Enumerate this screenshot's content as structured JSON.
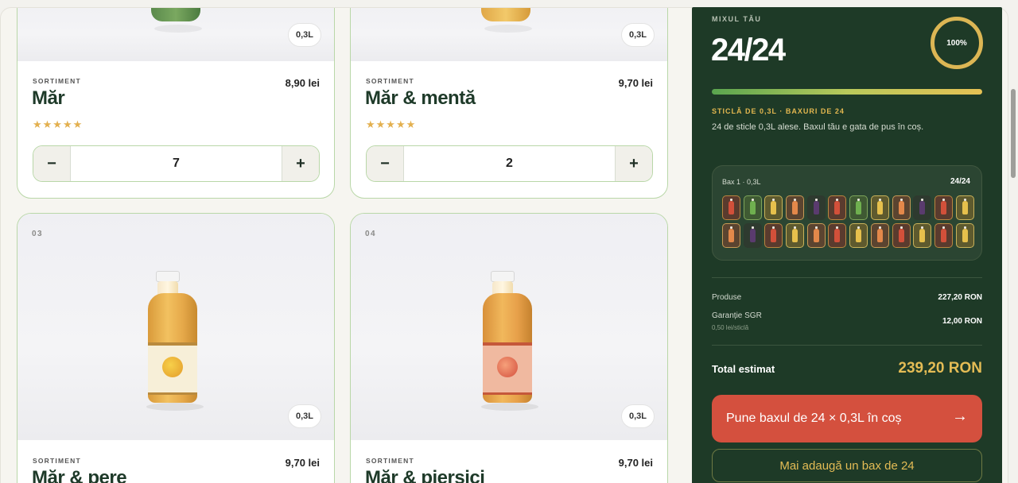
{
  "cards": [
    {
      "size": "0,3L",
      "sort_label": "SORTIMENT",
      "title": "Măr",
      "price": "8,90 lei",
      "stars": "★★★★★",
      "minus": "−",
      "plus": "+",
      "quantity": "7"
    },
    {
      "size": "0,3L",
      "sort_label": "SORTIMENT",
      "title": "Măr & mentă",
      "price": "9,70 lei",
      "stars": "★★★★★",
      "minus": "−",
      "plus": "+",
      "quantity": "2"
    },
    {
      "number": "03",
      "size": "0,3L",
      "sort_label": "SORTIMENT",
      "title": "Măr & pere",
      "price": "9,70 lei"
    },
    {
      "number": "04",
      "size": "0,3L",
      "sort_label": "SORTIMENT",
      "title": "Măr & piersici",
      "price": "9,70 lei"
    }
  ],
  "panel": {
    "mix_label": "MIXUL TĂU",
    "count": "24/24",
    "percent": "100%",
    "progress_fraction": 1.0,
    "sub_head": "STICLĂ DE 0,3L · BAXURI DE 24",
    "sub_text": "24 de sticle 0,3L alese. Baxul tău e gata de pus în coș.",
    "box_title": "Bax 1 · 0,3L",
    "box_count": "24/24",
    "products_label": "Produse",
    "products_value": "227,20 RON",
    "deposit_label": "Garanție SGR",
    "deposit_sub": "0,50 lei/sticlă",
    "deposit_value": "12,00 RON",
    "total_label": "Total estimat",
    "total_value": "239,20 RON",
    "cta_label": "Pune baxul de 24 × 0,3L în coș",
    "cta_arrow": "→",
    "secondary_label": "Mai adaugă un bax de 24"
  },
  "colors": {
    "brand_dark_green": "#1e3a27",
    "accent_gold": "#e4bc55",
    "cta_red": "#d4503e",
    "card_border": "#b9d7a8"
  },
  "bottle_slots": [
    "red",
    "green",
    "yellow",
    "orange",
    "purple",
    "red",
    "green",
    "yellow",
    "orange",
    "purple",
    "red",
    "yellow",
    "orange",
    "purple",
    "red",
    "yellow",
    "orange",
    "red",
    "yellow",
    "orange",
    "red",
    "yellow",
    "red",
    "yellow"
  ]
}
